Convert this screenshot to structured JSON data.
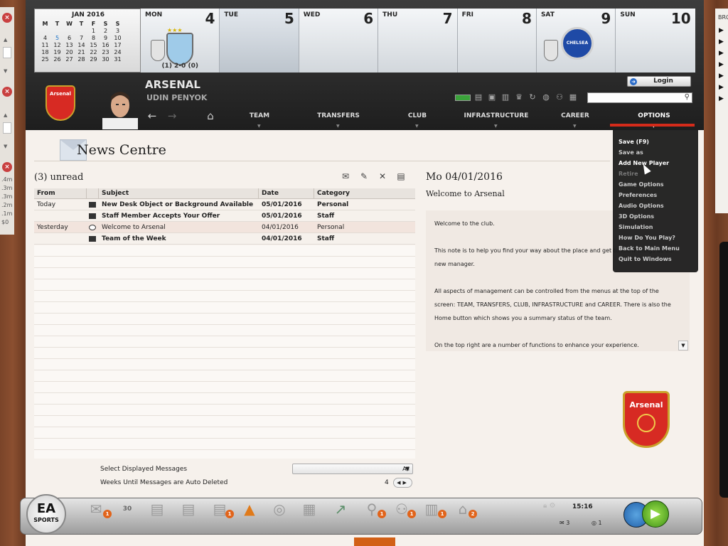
{
  "left_panel": {
    "values": [
      ".4m",
      ".3m",
      ".3m",
      ".2m",
      ".1m",
      "$0"
    ]
  },
  "right_panel": {
    "title": "BRO"
  },
  "calendar": {
    "month": "JAN 2016",
    "weekdays": [
      "M",
      "T",
      "W",
      "T",
      "F",
      "S",
      "S"
    ],
    "weeks": [
      [
        "",
        "",
        "",
        "",
        "1",
        "2",
        "3"
      ],
      [
        "4",
        "5",
        "6",
        "7",
        "8",
        "9",
        "10"
      ],
      [
        "11",
        "12",
        "13",
        "14",
        "15",
        "16",
        "17"
      ],
      [
        "18",
        "19",
        "20",
        "21",
        "22",
        "23",
        "24"
      ],
      [
        "25",
        "26",
        "27",
        "28",
        "29",
        "30",
        "31"
      ]
    ],
    "today": "5"
  },
  "days": [
    {
      "name": "MON",
      "num": "4",
      "score": "(1) 2-0 (0)"
    },
    {
      "name": "TUE",
      "num": "5"
    },
    {
      "name": "WED",
      "num": "6"
    },
    {
      "name": "THU",
      "num": "7"
    },
    {
      "name": "FRI",
      "num": "8"
    },
    {
      "name": "SAT",
      "num": "9"
    },
    {
      "name": "SUN",
      "num": "10"
    }
  ],
  "header": {
    "club": "ARSENAL",
    "manager": "UDIN PENYOK",
    "login": "Login",
    "crest_text": "Arsenal",
    "chelsea_text": "CHELSEA"
  },
  "nav": {
    "team": "TEAM",
    "transfers": "TRANSFERS",
    "club": "CLUB",
    "infrastructure": "INFRASTRUCTURE",
    "career": "CAREER",
    "options": "OPTIONS"
  },
  "options_menu": [
    "Save (F9)",
    "Save as",
    "Add New Player",
    "Retire",
    "Game Options",
    "Preferences",
    "Audio Options",
    "3D Options",
    "Simulation",
    "How Do You Play?",
    "Back to Main Menu",
    "Quit to Windows"
  ],
  "page": {
    "title": "News Centre",
    "unread": "(3) unread"
  },
  "table": {
    "columns": [
      "From",
      "",
      "Subject",
      "Date",
      "Category"
    ],
    "rows": [
      {
        "from": "Today",
        "subject": "New Desk Object or Background Available",
        "date": "05/01/2016",
        "category": "Personal",
        "read": false
      },
      {
        "from": "",
        "subject": "Staff Member Accepts Your Offer",
        "date": "05/01/2016",
        "category": "Staff",
        "read": false
      },
      {
        "from": "Yesterday",
        "subject": "Welcome to Arsenal",
        "date": "04/01/2016",
        "category": "Personal",
        "read": true
      },
      {
        "from": "",
        "subject": "Team of the Week",
        "date": "04/01/2016",
        "category": "Staff",
        "read": false
      }
    ]
  },
  "filters": {
    "select_label": "Select Displayed Messages",
    "select_value": "All",
    "weeks_label": "Weeks Until Messages are Auto Deleted",
    "weeks_value": "4"
  },
  "message": {
    "date": "Mo 04/01/2016",
    "subject": "Welcome to Arsenal",
    "paragraphs": [
      "Welcome to the club.",
      "This note is to help you find your way about the place and get to know things as our new manager.",
      "All aspects of management can be controlled from the menus at the top of the screen: TEAM, TRANSFERS, CLUB, INFRASTRUCTURE and CAREER. There is also the Home button which shows you a summary status of the team.",
      "On the top right are a number of functions to enhance your experience."
    ]
  },
  "bottom": {
    "ea_text": "EA",
    "ea_sub": "SPORTS",
    "calendar_icon_text": "30",
    "badges": {
      "mail": "1",
      "money3": "1",
      "search": "1",
      "people": "1",
      "books": "1",
      "home": "2"
    },
    "time": "15:16",
    "mail_count": "3",
    "support_count": "1"
  }
}
